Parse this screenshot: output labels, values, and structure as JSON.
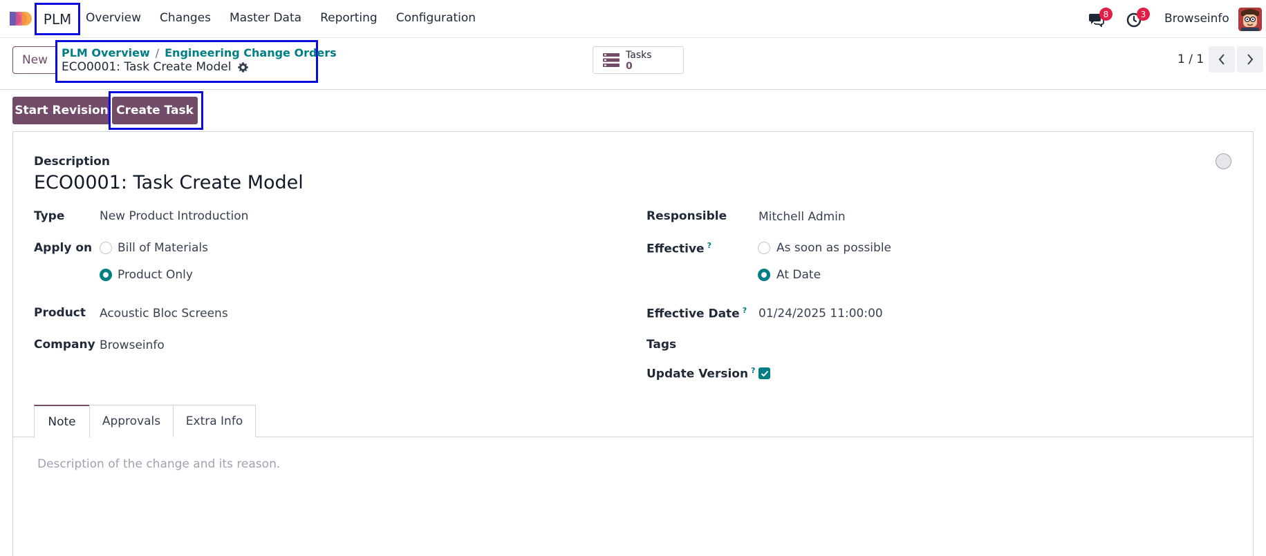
{
  "navbar": {
    "app_name": "PLM",
    "menu": [
      "Overview",
      "Changes",
      "Master Data",
      "Reporting",
      "Configuration"
    ],
    "chat_badge": "8",
    "activity_badge": "3",
    "company": "Browseinfo",
    "icons": [
      "app-logo-icon",
      "chat-icon",
      "clock-icon",
      "user-avatar"
    ]
  },
  "control_panel": {
    "new_label": "New",
    "breadcrumb": [
      "PLM Overview",
      "Engineering Change Orders"
    ],
    "breadcrumb_sep": "/",
    "record_title": "ECO0001: Task Create Model",
    "tasks_label": "Tasks",
    "tasks_count": "0",
    "pager": "1 / 1"
  },
  "status_bar": {
    "start_revision": "Start Revision",
    "create_task": "Create Task"
  },
  "form": {
    "description_label": "Description",
    "description": "ECO0001: Task Create Model",
    "type_label": "Type",
    "type": "New Product Introduction",
    "apply_on_label": "Apply on",
    "apply_on_options": [
      "Bill of Materials",
      "Product Only"
    ],
    "apply_on_selected": "Product Only",
    "product_label": "Product",
    "product": "Acoustic Bloc Screens",
    "company_label": "Company",
    "company": "Browseinfo",
    "responsible_label": "Responsible",
    "responsible": "Mitchell Admin",
    "effective_label": "Effective",
    "effective_options": [
      "As soon as possible",
      "At Date"
    ],
    "effective_selected": "At Date",
    "effective_date_label": "Effective Date",
    "effective_date": "01/24/2025 11:00:00",
    "tags_label": "Tags",
    "update_version_label": "Update Version",
    "update_version": true,
    "help_mark": "?"
  },
  "tabs": {
    "items": [
      "Note",
      "Approvals",
      "Extra Info"
    ],
    "active": "Note",
    "note_placeholder": "Description of the change and its reason."
  },
  "colors": {
    "brand": "#714b67",
    "accent": "#017e84",
    "highlight_box": "#0a0adc",
    "badge": "#e11d48"
  }
}
